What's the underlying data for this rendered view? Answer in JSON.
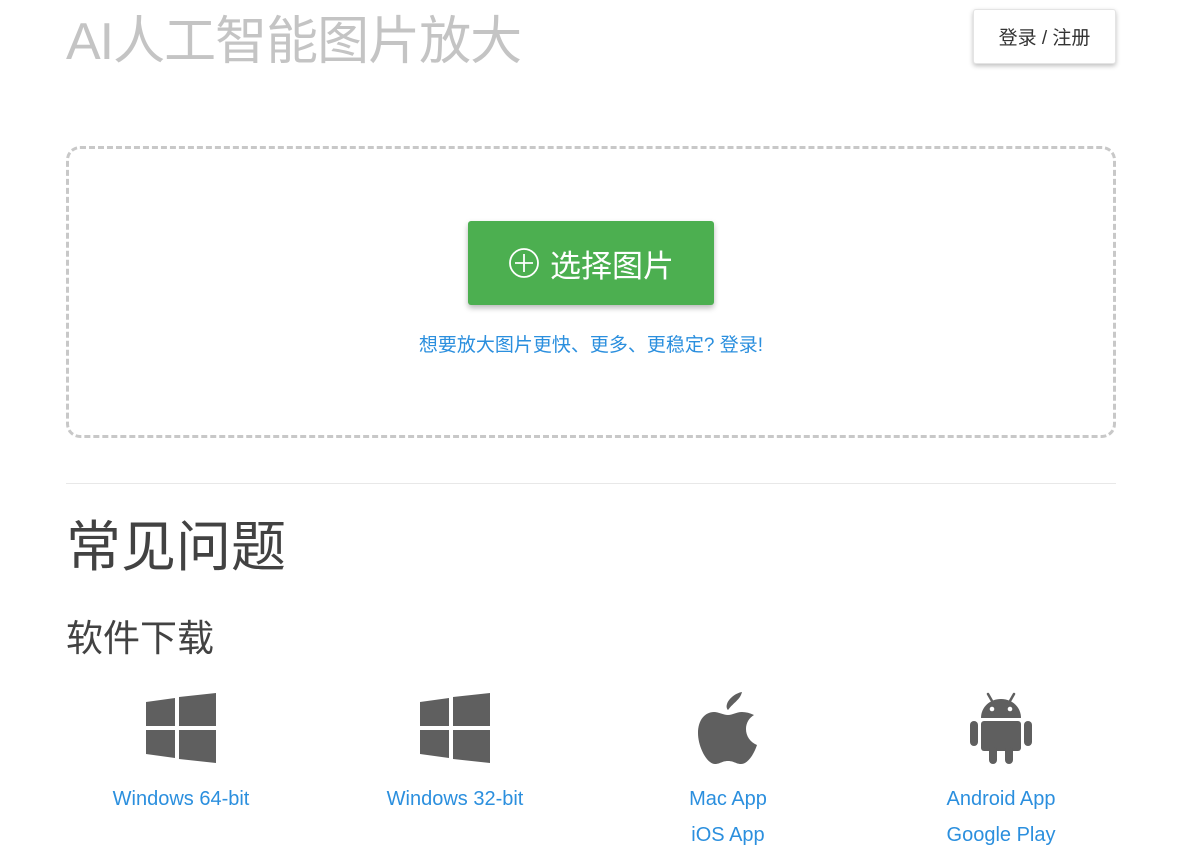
{
  "header": {
    "title": "AI人工智能图片放大",
    "login_label": "登录 / 注册"
  },
  "upload": {
    "select_label": "选择图片",
    "promo_text": "想要放大图片更快、更多、更稳定? 登录!"
  },
  "faq": {
    "heading": "常见问题"
  },
  "downloads": {
    "heading": "软件下载",
    "items": [
      {
        "icon": "windows-icon",
        "links": [
          "Windows 64-bit"
        ]
      },
      {
        "icon": "windows-icon",
        "links": [
          "Windows 32-bit"
        ]
      },
      {
        "icon": "apple-icon",
        "links": [
          "Mac App",
          "iOS App"
        ]
      },
      {
        "icon": "android-icon",
        "links": [
          "Android App",
          "Google Play"
        ]
      }
    ]
  },
  "colors": {
    "accent_green": "#4caf50",
    "link_blue": "#2b8fde",
    "icon_gray": "#5f5f5f",
    "title_gray": "#c4c4c4"
  }
}
